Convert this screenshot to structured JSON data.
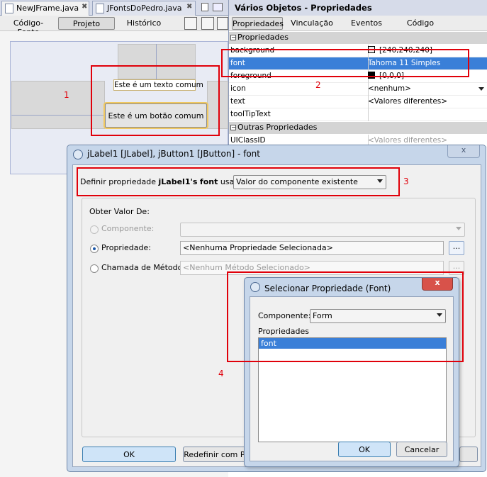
{
  "editor_tabs": [
    {
      "label": "NewJFrame.java",
      "close": "✖"
    },
    {
      "label": "JFontsDoPedro.java",
      "close": "✖"
    }
  ],
  "designer_toolbar": {
    "source": "Código-Fonte",
    "design": "Projeto",
    "history": "Histórico"
  },
  "canvas": {
    "label_text": "Este é um texto comum",
    "button_text": "Este é um botão comum"
  },
  "annotations": {
    "n1": "1",
    "n2": "2",
    "n3": "3",
    "n4": "4"
  },
  "properties_panel": {
    "title": "Vários Objetos - Propriedades",
    "tabs": [
      "Propriedades",
      "Vinculação",
      "Eventos",
      "Código"
    ],
    "section_props": "Propriedades",
    "section_other": "Outras Propriedades",
    "rows": [
      {
        "name": "background",
        "value": "[240,240,240]"
      },
      {
        "name": "font",
        "value": "Tahoma 11 Simples"
      },
      {
        "name": "foreground",
        "value": "[0,0,0]"
      },
      {
        "name": "icon",
        "value": "<nenhum>"
      },
      {
        "name": "text",
        "value": "<Valores diferentes>"
      },
      {
        "name": "toolTipText",
        "value": ""
      },
      {
        "name": "UIClassID",
        "value": "<Valores diferentes>"
      }
    ],
    "colors": {
      "background_swatch": "#f0f0f0",
      "foreground_swatch": "#000000",
      "selected_row": "#3a7fd8"
    }
  },
  "dialog_property": {
    "title": "jLabel1 [JLabel], jButton1 [JButton] - font",
    "close": "x",
    "define_prefix": "Definir propriedade ",
    "define_component": "jLabel1's",
    "define_prop": "font",
    "define_suffix": " usando:",
    "mode_value": "Valor do componente existente",
    "group_title": "Obter Valor De:",
    "opt_component": "Componente:",
    "opt_property": "Propriedade:",
    "opt_property_value": "<Nenhuma Propriedade Selecionada>",
    "opt_method": "Chamada de Método:",
    "opt_method_value": "<Nenhum Método Selecionado>",
    "ellipsis": "...",
    "ok": "OK",
    "reset": "Redefinir com Padrão"
  },
  "dialog_select": {
    "title": "Selecionar Propriedade (Font)",
    "close": "x",
    "component_label": "Componente:",
    "component_value": "Form",
    "props_label": "Propriedades",
    "props_list": [
      "font"
    ],
    "ok": "OK",
    "cancel": "Cancelar"
  }
}
